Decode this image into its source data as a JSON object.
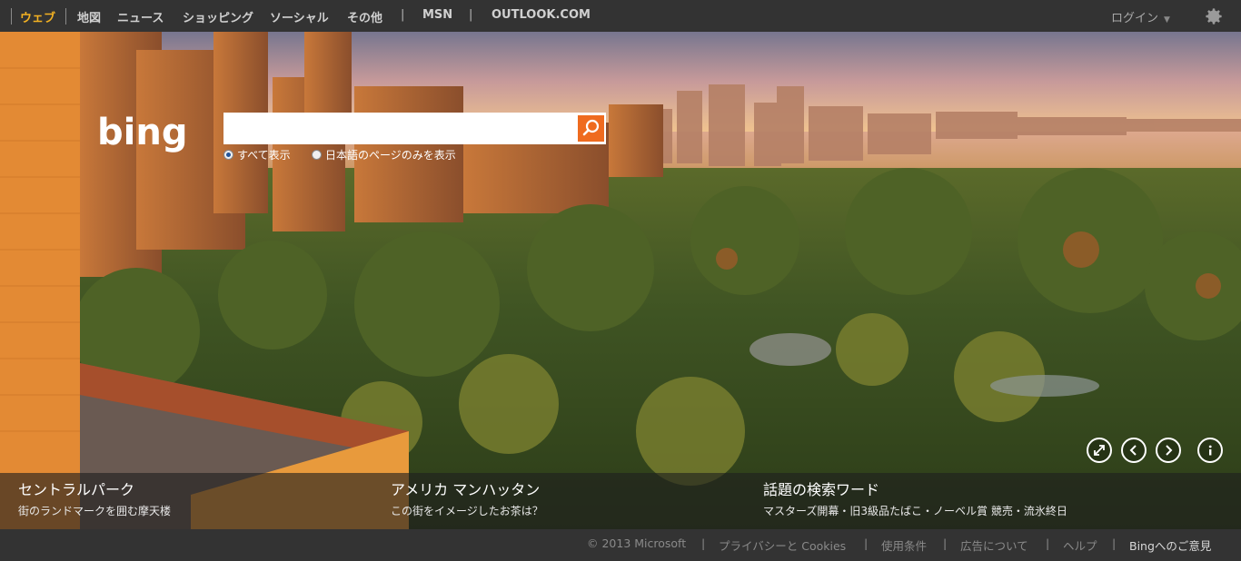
{
  "nav": {
    "items": [
      {
        "label": "ウェブ",
        "active": true
      },
      {
        "label": "地図"
      },
      {
        "label": "ニュース"
      },
      {
        "label": "ショッピング"
      },
      {
        "label": "ソーシャル"
      },
      {
        "label": "その他"
      },
      {
        "label": "MSN"
      },
      {
        "label": "OUTLOOK.COM"
      }
    ],
    "login_label": "ログイン",
    "settings_icon": "gear-icon"
  },
  "search": {
    "logo_text": "bing",
    "query": "",
    "button_icon": "search-icon",
    "options": [
      {
        "label": "すべて表示",
        "selected": true
      },
      {
        "label": "日本語のページのみを表示",
        "selected": false
      }
    ]
  },
  "hero_controls": [
    {
      "icon": "expand-icon"
    },
    {
      "icon": "chevron-left-icon"
    },
    {
      "icon": "chevron-right-icon"
    },
    {
      "icon": "info-icon"
    }
  ],
  "captions": [
    {
      "title": "セントラルパーク",
      "subtitle": "街のランドマークを囲む摩天楼"
    },
    {
      "title": "アメリカ マンハッタン",
      "subtitle": "この街をイメージしたお茶は？"
    },
    {
      "title": "話題の検索ワード",
      "subtitle": "マスターズ開幕・旧3級品たばこ・ノーベル賞 競売・流氷終日"
    }
  ],
  "footer": {
    "copyright": "© 2013 Microsoft",
    "links": [
      "プライバシーと Cookies",
      "使用条件",
      "広告について",
      "ヘルプ",
      "Bingへのご意見"
    ]
  },
  "colors": {
    "accent_active_tab": "#f4b222",
    "search_button": "#ef6b1f",
    "bar_background": "#333333"
  }
}
